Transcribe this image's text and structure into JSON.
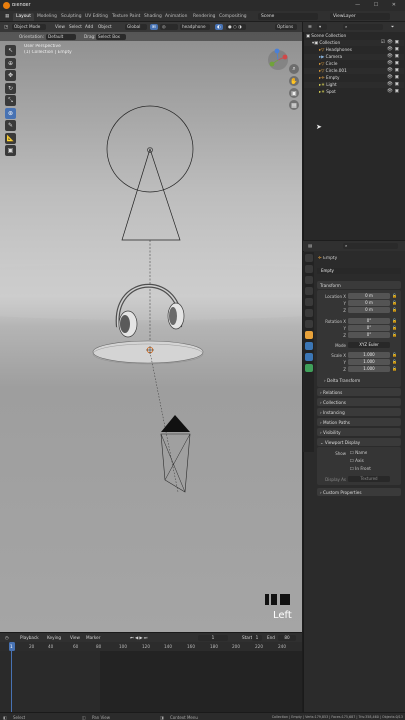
{
  "window": {
    "title": "Blender",
    "controls": "— ☐ ✕"
  },
  "menu": {
    "workspaces": [
      "Layout",
      "Modeling",
      "Sculpting",
      "UV Editing",
      "Texture Paint",
      "Shading",
      "Animation",
      "Rendering",
      "Compositing"
    ],
    "active_workspace": "Layout",
    "scene": "Scene",
    "view_layer": "ViewLayer"
  },
  "viewport": {
    "mode": "Object Mode",
    "menus": [
      "View",
      "Select",
      "Add",
      "Object"
    ],
    "transform_orientation": "Global",
    "search_value": "headphone",
    "options_label": "Options",
    "orientation_label": "Orientation:",
    "orientation_value": "Default",
    "drag_label": "Drag:",
    "drag_value": "Select Box",
    "info_line1": "User Perspective",
    "info_line2": "(1) Collection | Empty",
    "corner_view_label": "Left"
  },
  "timeline": {
    "menus": [
      "Playback",
      "Keying",
      "View",
      "Marker"
    ],
    "current_frame": "1",
    "start_label": "Start",
    "start": "1",
    "end_label": "End",
    "end": "80",
    "ruler": [
      "1",
      "20",
      "40",
      "60",
      "80",
      "100",
      "120",
      "140",
      "160",
      "180",
      "200",
      "220",
      "240"
    ]
  },
  "status": {
    "select": "Select",
    "pan": "Pan View",
    "context": "Context Menu",
    "stats": "Collection | Empty | Verts:179,853 | Faces:175,687 | Tris:358,460 | Objects:0/13"
  },
  "outliner": {
    "root": "Scene Collection",
    "items": [
      {
        "name": "Collection",
        "indent": 1
      },
      {
        "name": "Headphones",
        "indent": 2
      },
      {
        "name": "Camera",
        "indent": 2
      },
      {
        "name": "Circle",
        "indent": 2
      },
      {
        "name": "Circle.001",
        "indent": 2
      },
      {
        "name": "Empty",
        "indent": 2
      },
      {
        "name": "Light",
        "indent": 2
      },
      {
        "name": "Spot",
        "indent": 2
      }
    ]
  },
  "properties": {
    "object_name": "Empty",
    "object_field": "Empty",
    "transform_label": "Transform",
    "location_label": "Location X",
    "rotation_label": "Rotation X",
    "scale_label": "Scale X",
    "axis_y": "Y",
    "axis_z": "Z",
    "location": [
      "0 m",
      "0 m",
      "0 m"
    ],
    "rotation": [
      "0°",
      "0°",
      "0°"
    ],
    "mode_label": "Mode",
    "mode_value": "XYZ Euler",
    "scale": [
      "1.000",
      "1.000",
      "1.000"
    ],
    "delta_transform": "Delta Transform",
    "collapsed_panels": [
      "Relations",
      "Collections",
      "Instancing",
      "Motion Paths",
      "Visibility"
    ],
    "viewport_display": "Viewport Display",
    "show_label": "Show",
    "show_options": [
      "Name",
      "Axis",
      "In Front"
    ],
    "display_as_label": "Display As",
    "display_as_value": "Textured",
    "custom_properties": "Custom Properties"
  },
  "colors": {
    "accent_blue": "#4772b3",
    "blender_orange": "#e87d0d",
    "camera_triangle": "#111111"
  }
}
